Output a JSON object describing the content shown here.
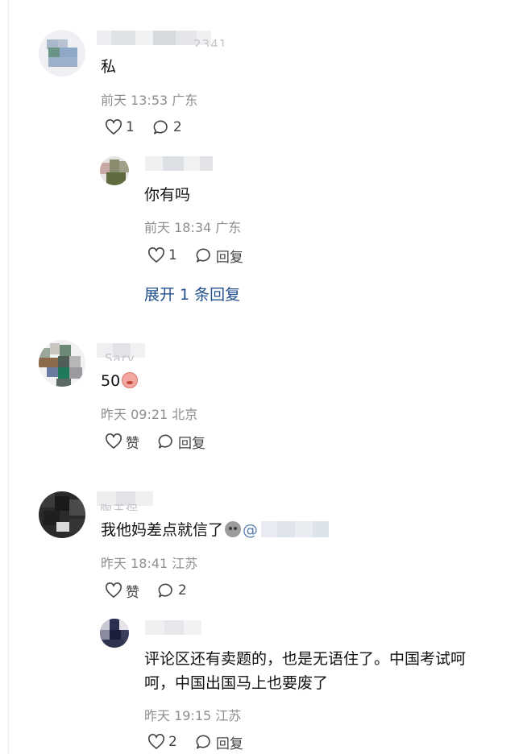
{
  "comments": [
    {
      "name_fragment": "2341",
      "text": "私",
      "meta": "前天 13:53 广东",
      "like": "1",
      "reply": "2",
      "replies": [
        {
          "name_fragment": "",
          "text": "你有吗",
          "meta": "前天 18:34 广东",
          "like": "1",
          "reply": "回复"
        }
      ],
      "expand_label": "展开 1 条回复"
    },
    {
      "name_fragment": "Sary",
      "text": "50",
      "meta": "昨天 09:21 北京",
      "like": "赞",
      "reply": "回复"
    },
    {
      "name_fragment": "陶王保",
      "text": "我他妈差点就信了",
      "meta": "昨天 18:41 江苏",
      "like": "赞",
      "reply": "2",
      "replies": [
        {
          "name_fragment": "",
          "text_line1": "评论区还有卖题的，也是无语住了。中国考试呵",
          "text_line2": "呵，中国出国马上也要废了",
          "meta": "昨天 19:15 江苏",
          "like": "2",
          "reply": "回复"
        }
      ]
    }
  ],
  "colors": {
    "link": "#1f4e8c",
    "meta": "#8e8e93",
    "text": "#111111"
  },
  "icons": {
    "like": "heart-outline-icon",
    "reply": "speech-bubble-icon"
  }
}
